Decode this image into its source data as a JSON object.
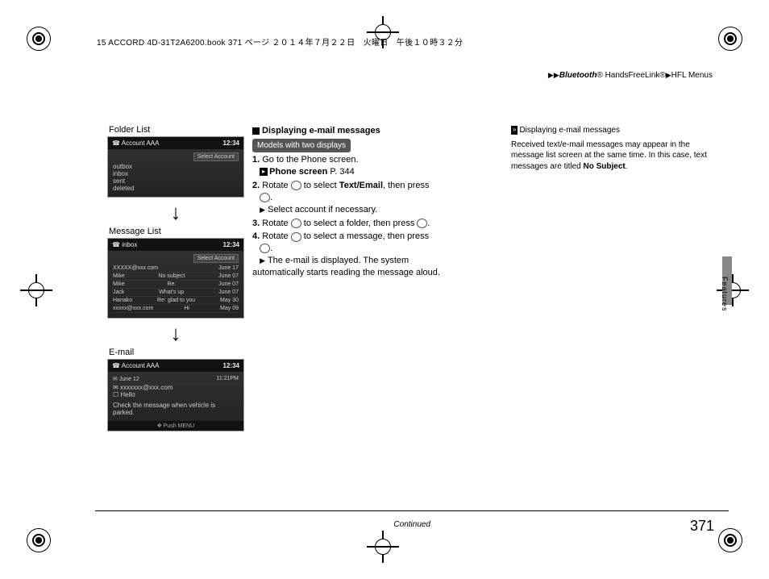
{
  "slug": "15 ACCORD 4D-31T2A6200.book  371 ページ  ２０１４年７月２２日　火曜日　午後１０時３２分",
  "breadcrumb": {
    "a": "Bluetooth",
    "b": "® HandsFreeLink®",
    "c": "HFL Menus"
  },
  "col1": {
    "s1_label": "Folder List",
    "s1_title": "Account AAA",
    "s1_time": "12:34",
    "s1_sel": "Select Account",
    "s1_items": [
      "outbox",
      "inbox",
      "sent",
      "deleted"
    ],
    "s2_label": "Message List",
    "s2_title": "inbox",
    "s2_time": "12:34",
    "s2_sel": "Select Account",
    "s2_rows": [
      {
        "a": "XXXXX@xxx.com",
        "b": "",
        "c": "June 17"
      },
      {
        "a": "Mike",
        "b": "No subject",
        "c": "June 07"
      },
      {
        "a": "Mike",
        "b": "Re:",
        "c": "June 07"
      },
      {
        "a": "Jack",
        "b": "What's up",
        "c": "June 07"
      },
      {
        "a": "Hanako",
        "b": "Re: glad to you",
        "c": "May 30"
      },
      {
        "a": "xxxxx@xxx.com",
        "b": "Hi",
        "c": "May 09"
      }
    ],
    "s3_label": "E-mail",
    "s3_title": "Account AAA",
    "s3_time": "12:34",
    "s3_date": "June 12",
    "s3_t": "11:21PM",
    "s3_from": "xxxxxxx@xxx.com",
    "s3_subj": "Hello",
    "s3_msg": "Check the message when vehicle is parked.",
    "s3_foot": "Push MENU"
  },
  "col2": {
    "h": "Displaying e-mail messages",
    "pill": "Models with two displays",
    "s1a": "1.",
    "s1b": "Go to the Phone screen.",
    "ref": "Phone screen",
    "refp": "P. 344",
    "s2a": "2.",
    "s2b_pre": "Rotate ",
    "s2b_mid": " to select ",
    "s2b_bold": "Text/Email",
    "s2b_post": ", then press ",
    "s2c": "Select account if necessary.",
    "s3a": "3.",
    "s3b_pre": "Rotate ",
    "s3b_post": " to select a folder, then press ",
    "s4a": "4.",
    "s4b_pre": "Rotate ",
    "s4b_post": " to select a message, then press ",
    "s4c": "The e-mail is displayed. The system automatically starts reading the message aloud."
  },
  "col3": {
    "h": "Displaying e-mail messages",
    "p1": "Received text/e-mail messages may appear in the message list screen at the same time. In this case, text messages are titled ",
    "p1b": "No Subject",
    "p1c": "."
  },
  "features": "Features",
  "continued": "Continued",
  "pagenum": "371"
}
